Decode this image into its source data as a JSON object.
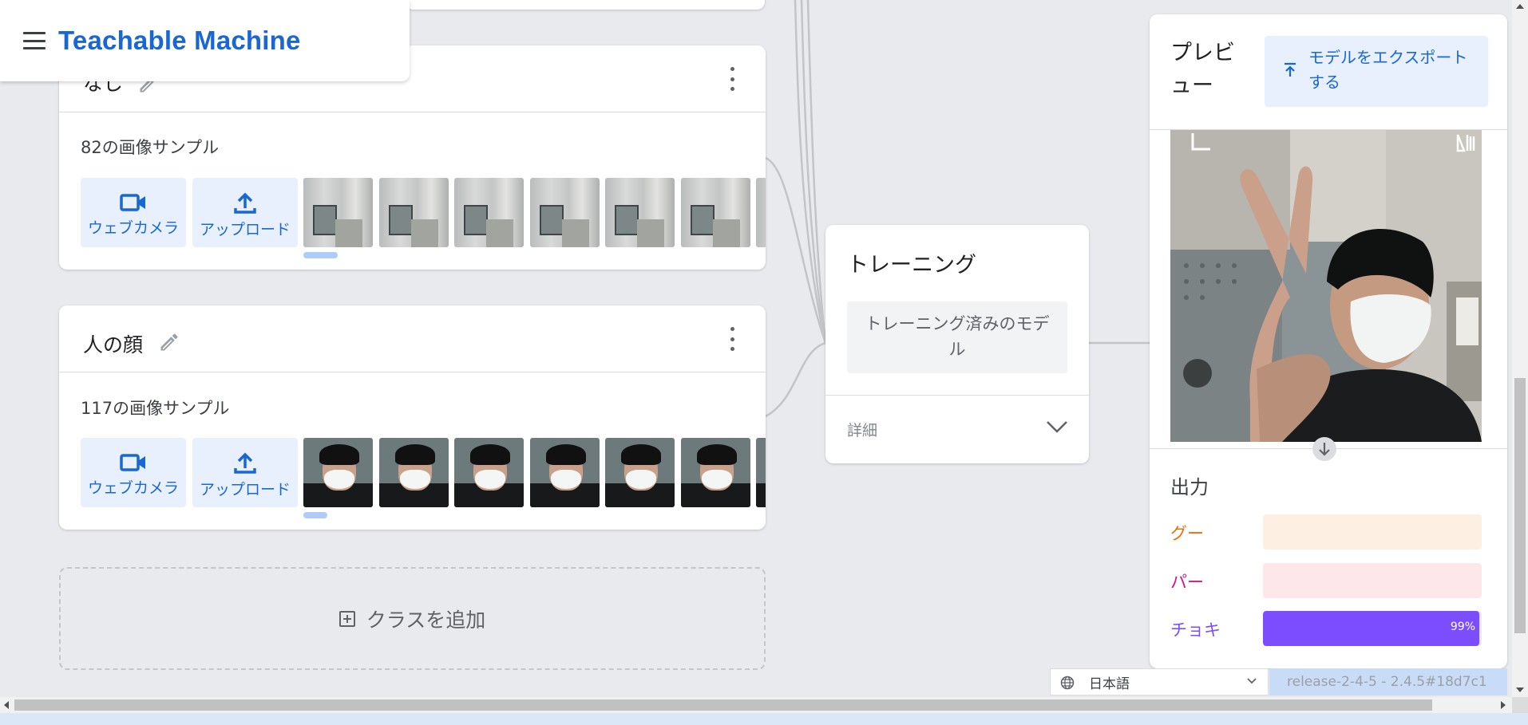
{
  "header": {
    "title": "Teachable Machine"
  },
  "classes": [
    {
      "name": "なし",
      "sample_count": "82の画像サンプル",
      "webcam_label": "ウェブカメラ",
      "upload_label": "アップロード",
      "thumb_kind": "empty",
      "thumb_count": 7
    },
    {
      "name": "人の顔",
      "sample_count": "117の画像サンプル",
      "webcam_label": "ウェブカメラ",
      "upload_label": "アップロード",
      "thumb_kind": "face",
      "thumb_count": 7
    }
  ],
  "add_class": {
    "label": "クラスを追加"
  },
  "training": {
    "title": "トレーニング",
    "button_label": "トレーニング済みのモデル",
    "details_label": "詳細"
  },
  "preview": {
    "title": "プレビュー",
    "export_label": "モデルをエクスポートする",
    "output_title": "出力",
    "outputs": [
      {
        "label": "グー",
        "percent": 0,
        "label_color": "#e8710a",
        "track_color": "#feefe3",
        "fill_color": "#e8710a"
      },
      {
        "label": "パー",
        "percent": 0,
        "label_color": "#d01884",
        "track_color": "#fde7ea",
        "fill_color": "#d01884"
      },
      {
        "label": "チョキ",
        "percent": 99,
        "percent_text": "99%",
        "label_color": "#7c4dff",
        "track_color": "#ede7ff",
        "fill_color": "#7c4dff"
      }
    ]
  },
  "footer": {
    "language": "日本語",
    "release": "release-2-4-5 - 2.4.5#18d7c1"
  },
  "colors": {
    "brand_blue": "#1967d2",
    "background": "#e8eaed",
    "button_tint": "#e8f0fe"
  }
}
